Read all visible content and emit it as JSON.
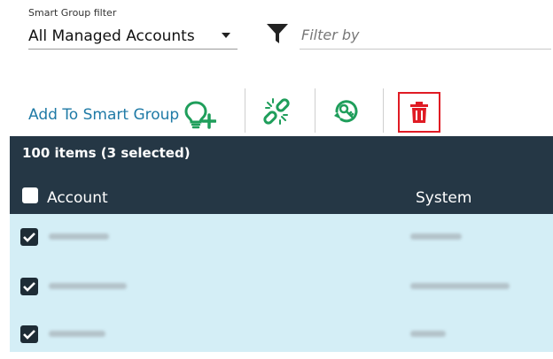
{
  "smart_group": {
    "label": "Smart Group filter",
    "selected": "All Managed Accounts"
  },
  "filter": {
    "placeholder": "Filter by"
  },
  "toolbar": {
    "add_label": "Add To Smart Group",
    "icons": [
      "lightbulb-add-icon",
      "unlink-icon",
      "key-rotate-icon",
      "trash-icon"
    ],
    "colors": {
      "link": "#1f7aa6",
      "icon_green": "#1f9e5b",
      "delete_red": "#e01b24"
    }
  },
  "grid": {
    "count_text": "100 items (3 selected)",
    "columns": [
      "Account",
      "System"
    ],
    "rows": [
      {
        "checked": true
      },
      {
        "checked": true
      },
      {
        "checked": true
      }
    ],
    "colors": {
      "header_bg": "#253745",
      "row_bg": "#d4eef6"
    }
  }
}
